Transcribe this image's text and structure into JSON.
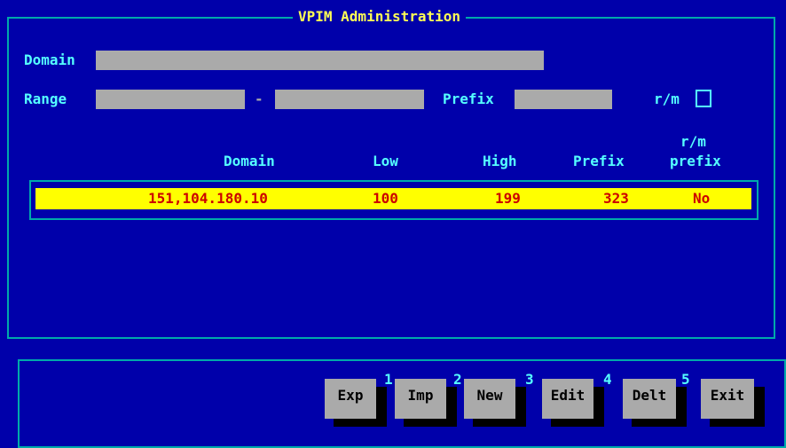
{
  "window": {
    "title": "VPIM Administration"
  },
  "form": {
    "domain_label": "Domain",
    "domain_value": "",
    "range_label": "Range",
    "range_low_value": "",
    "range_separator": "-",
    "range_high_value": "",
    "prefix_label": "Prefix",
    "prefix_value": "",
    "rm_label": "r/m",
    "rm_checked": false
  },
  "table": {
    "headers": {
      "domain": "Domain",
      "low": "Low",
      "high": "High",
      "prefix": "Prefix",
      "rm_prefix_line1": "r/m",
      "rm_prefix_line2": "prefix"
    },
    "rows": [
      {
        "domain": "151,104.180.10",
        "low": "100",
        "high": "199",
        "prefix": "323",
        "rm_prefix": "No"
      }
    ]
  },
  "buttons": [
    {
      "label": "Exp",
      "fkey": ""
    },
    {
      "label": "Imp",
      "fkey": "1"
    },
    {
      "label": "New",
      "fkey": "2"
    },
    {
      "label": "Edit",
      "fkey": "3"
    },
    {
      "label": "Delt",
      "fkey": "4"
    },
    {
      "label": "Exit",
      "fkey": "5"
    }
  ],
  "colors": {
    "background": "#0000aa",
    "frame": "#00aaaa",
    "label": "#55ffff",
    "title": "#ffff55",
    "selected_row": "#ffff00",
    "selected_text": "#cc0000",
    "button": "#aaaaaa"
  }
}
